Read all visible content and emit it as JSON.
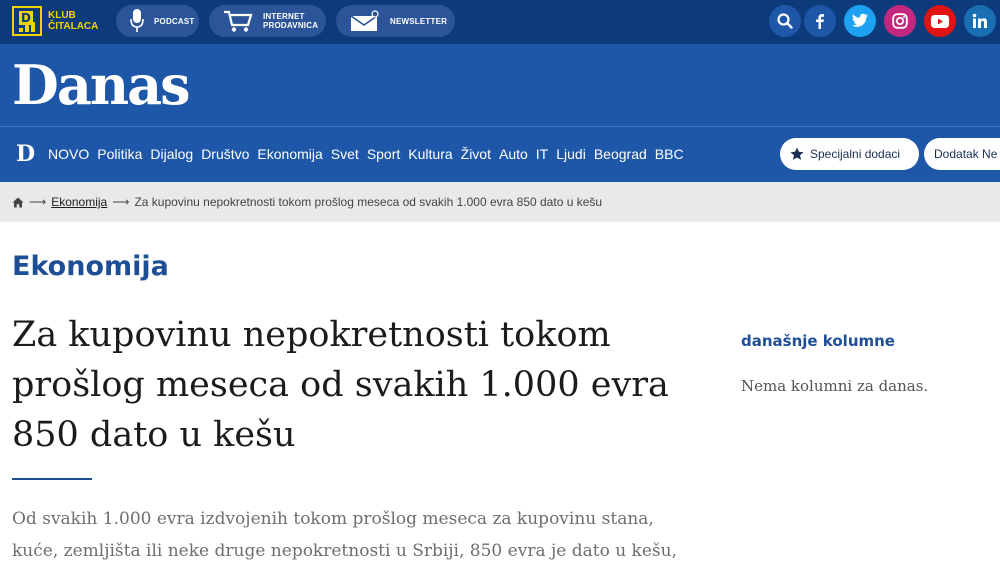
{
  "topbar": {
    "klub_label": [
      "KLUB",
      "ČITALACA"
    ],
    "podcast_label": "PODCAST",
    "shop_label": [
      "INTERNET",
      "PRODAVNICA"
    ],
    "newsletter_label": "NEWSLETTER",
    "social": [
      {
        "icon": "search-icon",
        "color": "#1e57a8"
      },
      {
        "icon": "facebook-icon",
        "color": "#1e57a8"
      },
      {
        "icon": "twitter-icon",
        "color": "#1da1f2"
      },
      {
        "icon": "instagram-icon",
        "color": "#c3287e"
      },
      {
        "icon": "youtube-icon",
        "color": "#e01414"
      },
      {
        "icon": "linkedin-icon",
        "color": "#1a6fb3"
      }
    ]
  },
  "brand": {
    "logo": "Danas",
    "nav_logo": "D"
  },
  "nav": {
    "items": [
      "NOVO",
      "Politika",
      "Dijalog",
      "Društvo",
      "Ekonomija",
      "Svet",
      "Sport",
      "Kultura",
      "Život",
      "Auto",
      "IT",
      "Ljudi",
      "Beograd",
      "BBC"
    ],
    "special_button": "Specijalni dodaci",
    "supplement_button": "Dodatak Ne"
  },
  "breadcrumb": {
    "category": "Ekonomija",
    "current": "Za kupovinu nepokretnosti tokom prošlog meseca od svakih 1.000 evra 850 dato u kešu"
  },
  "article": {
    "section": "Ekonomija",
    "title": "Za kupovinu nepokretnosti tokom prošlog meseca od svakih 1.000 evra 850 dato u kešu",
    "lead": "Od svakih 1.000 evra izdvojenih tokom prošlog meseca za kupovinu stana, kuće, zemljišta ili neke druge nepokretnosti u Srbiji, 850 evra je dato u kešu,"
  },
  "sidebar": {
    "columns_title": "današnje kolumne",
    "columns_empty": "Nema kolumni za danas."
  },
  "colors": {
    "topbar": "#0c3a7a",
    "brand_blue": "#1e57a8",
    "accent_yellow": "#f2d300"
  }
}
